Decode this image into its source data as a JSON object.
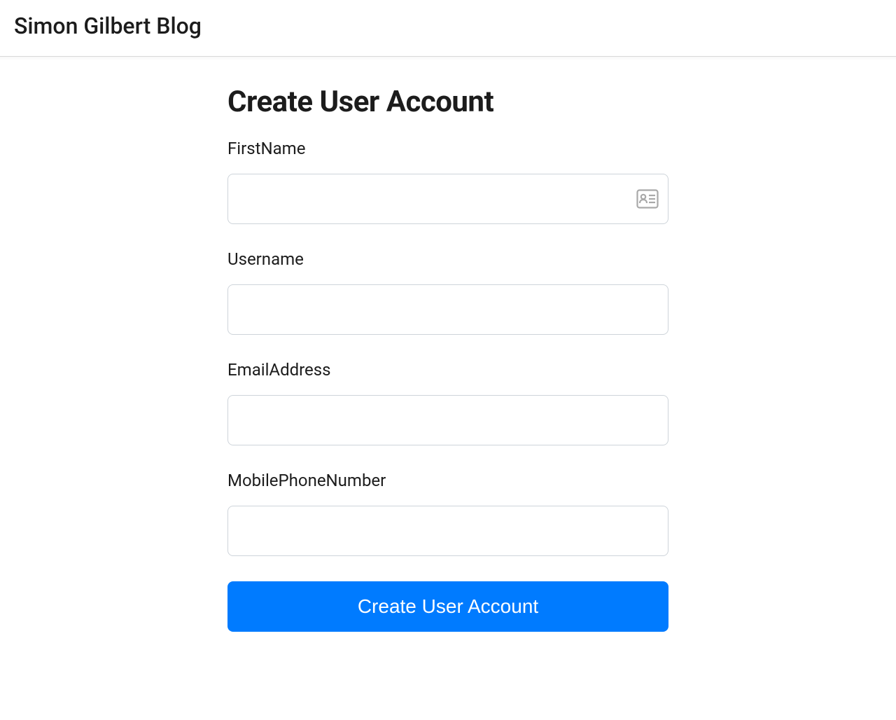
{
  "header": {
    "site_title": "Simon Gilbert Blog"
  },
  "page": {
    "title": "Create User Account"
  },
  "form": {
    "fields": {
      "first_name": {
        "label": "FirstName",
        "value": ""
      },
      "username": {
        "label": "Username",
        "value": ""
      },
      "email": {
        "label": "EmailAddress",
        "value": ""
      },
      "phone": {
        "label": "MobilePhoneNumber",
        "value": ""
      }
    },
    "submit_label": "Create User Account"
  },
  "colors": {
    "primary": "#007bff",
    "text": "#1c1c1c",
    "border": "#ced4da",
    "icon": "#a9a9a9"
  }
}
